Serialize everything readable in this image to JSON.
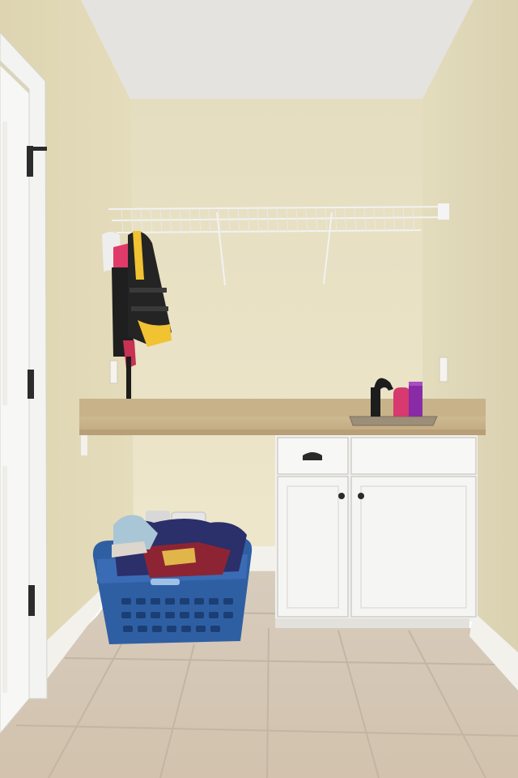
{
  "scene": {
    "description_visible_text": [],
    "colors": {
      "ceiling": "#e6e5e0",
      "back_wall": "#ebe4c7",
      "left_wall": "#e3dbb9",
      "right_wall": "#e6dfc0",
      "floor_tile": "#d6c8b6",
      "grout": "#c2b4a2",
      "counter": "#c9b48e",
      "cabinet": "#f3f3f1",
      "basket": "#2f5fa3",
      "door": "#f6f6f4",
      "trim": "#f4f4f2"
    }
  }
}
